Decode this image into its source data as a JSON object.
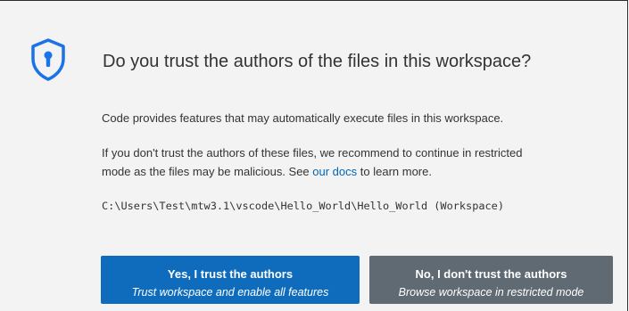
{
  "dialog": {
    "icon": "shield-keyhole-icon",
    "title": "Do you trust the authors of the files in this workspace?",
    "message1": "Code provides features that may automatically execute files in this workspace.",
    "message2_line1": "If you don't trust the authors of these files, we recommend to continue in restricted",
    "message2_line2_prefix": "mode as the files may be malicious. See ",
    "message2_link": "our docs",
    "message2_line2_suffix": " to learn more.",
    "workspace_path": "C:\\Users\\Test\\mtw3.1\\vscode\\Hello_World\\Hello_World (Workspace)"
  },
  "buttons": {
    "trust": {
      "label": "Yes, I trust the authors",
      "sublabel": "Trust workspace and enable all features"
    },
    "distrust": {
      "label": "No, I don't trust the authors",
      "sublabel": "Browse workspace in restricted mode"
    }
  },
  "colors": {
    "primary_button": "#0f6cbd",
    "secondary_button": "#5f6a73",
    "icon_blue": "#1a73e8",
    "link": "#0067b8"
  }
}
